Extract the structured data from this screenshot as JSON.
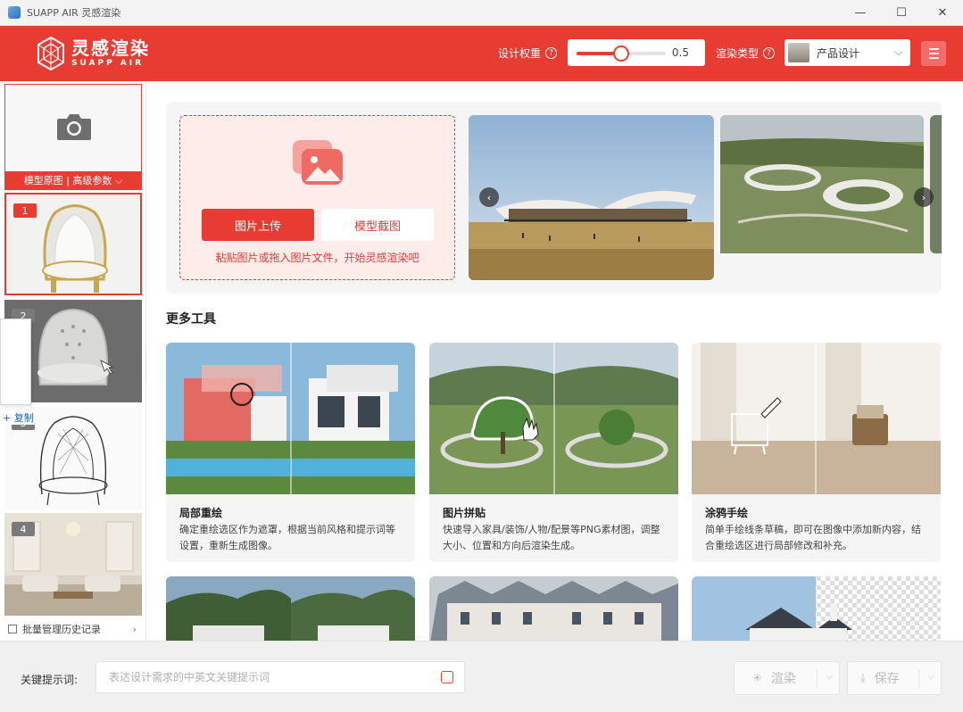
{
  "window": {
    "title": "SUAPP AIR 灵感渲染",
    "minimize": "—",
    "maximize": "☐",
    "close": "✕"
  },
  "header": {
    "logo_cn": "灵感渲染",
    "logo_en": "SUAPP AIR",
    "weight_label": "设计权重",
    "weight_value": "0.5",
    "weight_fraction": 0.5,
    "render_type_label": "渲染类型",
    "render_type_value": "产品设计"
  },
  "sidebar": {
    "upload_label": "模型原图 | 高级参数 ⌵",
    "thumbnails": [
      {
        "num": "1",
        "selected": true
      },
      {
        "num": "2",
        "selected": false
      },
      {
        "num": "3",
        "selected": false
      },
      {
        "num": "4",
        "selected": false
      }
    ],
    "copy_label": "+ 复制",
    "batch_label": "批量管理历史记录",
    "batch_chevron": "›",
    "collapse": "‹"
  },
  "hero": {
    "upload_button": "图片上传",
    "model_button": "模型截图",
    "hint": "粘贴图片或拖入图片文件，开始灵感渲染吧",
    "prev": "‹",
    "next": "›"
  },
  "tools": {
    "section_title": "更多工具",
    "cards": [
      {
        "title": "局部重绘",
        "desc": "确定重绘选区作为遮罩，根据当前风格和提示词等设置，重新生成图像。"
      },
      {
        "title": "图片拼贴",
        "desc": "快速导入家具/装饰/人物/配景等PNG素材图，调整大小、位置和方向后渲染生成。"
      },
      {
        "title": "涂鸦手绘",
        "desc": "简单手绘线条草稿，即可在图像中添加新内容，结合重绘选区进行局部修改和补充。"
      }
    ]
  },
  "bottom": {
    "keyword_label": "关键提示词:",
    "keyword_placeholder": "表达设计需求的中英文关键提示词",
    "render_button": "渲染",
    "save_button": "保存",
    "dropdown": "⌵"
  },
  "colors": {
    "accent": "#e83c33",
    "accent_light": "#fdecea"
  }
}
